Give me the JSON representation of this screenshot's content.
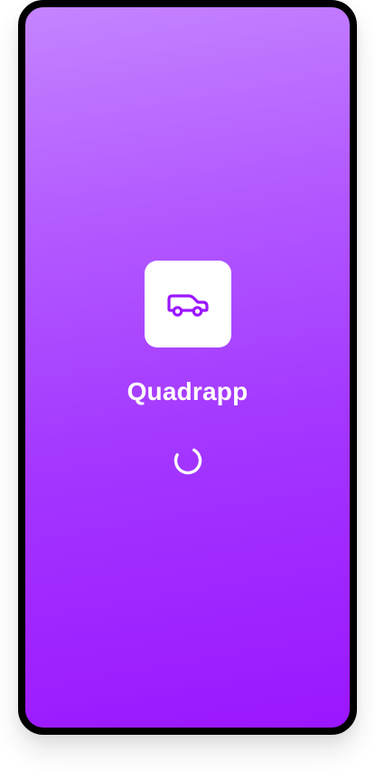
{
  "app": {
    "name": "Quadrapp",
    "icon": "car-icon",
    "loading_indicator": "spinner-icon"
  },
  "colors": {
    "gradient_top": "#c584ff",
    "gradient_bottom": "#9b16ff",
    "accent": "#9b16ff",
    "icon_tile": "#ffffff",
    "text": "#ffffff",
    "device_frame": "#000000"
  }
}
